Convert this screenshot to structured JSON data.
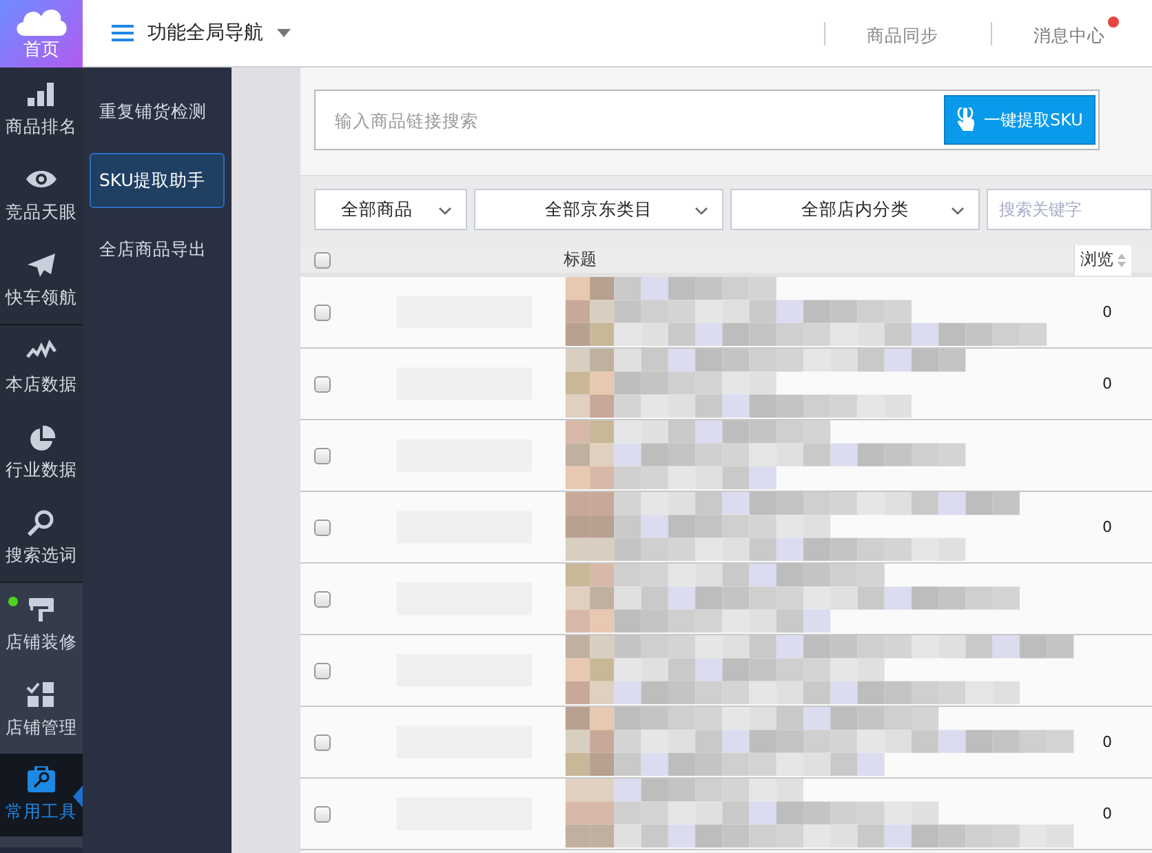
{
  "logo": {
    "label": "首页"
  },
  "header": {
    "nav_title": "功能全局导航",
    "links": [
      {
        "label": "商品同步",
        "unread": false
      },
      {
        "label": "消息中心",
        "unread": true
      }
    ]
  },
  "nav_groups": [
    {
      "kind": "plain",
      "items": [
        {
          "kind": "bars",
          "label": "商品排名",
          "selected": false,
          "notification": false
        },
        {
          "kind": "eye",
          "label": "竞品天眼",
          "selected": false,
          "notification": false
        },
        {
          "kind": "plane",
          "label": "快车领航",
          "selected": false,
          "notification": false
        }
      ]
    },
    {
      "kind": "plain",
      "items": [
        {
          "kind": "wave",
          "label": "本店数据",
          "selected": false,
          "notification": false
        },
        {
          "kind": "pie",
          "label": "行业数据",
          "selected": false,
          "notification": false
        },
        {
          "kind": "search",
          "label": "搜索选词",
          "selected": false,
          "notification": false
        }
      ]
    },
    {
      "kind": "highlighted",
      "items": [
        {
          "kind": "roller",
          "label": "店铺装修",
          "selected": false,
          "notification": true
        },
        {
          "kind": "grid",
          "label": "店铺管理",
          "selected": false,
          "notification": false
        }
      ]
    },
    {
      "kind": "plain",
      "items": [
        {
          "kind": "toolbox",
          "label": "常用工具",
          "selected": true,
          "notification": false
        }
      ]
    }
  ],
  "sub_menu": [
    {
      "label": "重复铺货检测",
      "selected": false
    },
    {
      "label": "SKU提取助手",
      "selected": true
    },
    {
      "label": "全店商品导出",
      "selected": false
    }
  ],
  "link_search": {
    "placeholder": "输入商品链接搜索",
    "button": "一键提取SKU"
  },
  "filters": [
    {
      "label": "全部商品"
    },
    {
      "label": "全部京东类目"
    },
    {
      "label": "全部店内分类"
    }
  ],
  "keyword_search": {
    "placeholder": "搜索关键字"
  },
  "table": {
    "select_all": {
      "checked": false
    },
    "columns": [
      "标题",
      "浏览"
    ],
    "rows": [
      {
        "checked": false,
        "views": "0"
      },
      {
        "checked": false,
        "views": "0"
      },
      {
        "checked": false
      },
      {
        "checked": false,
        "views": "0"
      },
      {
        "checked": false
      },
      {
        "checked": false
      },
      {
        "checked": false,
        "views": "0"
      },
      {
        "checked": false,
        "views": "0"
      }
    ]
  }
}
